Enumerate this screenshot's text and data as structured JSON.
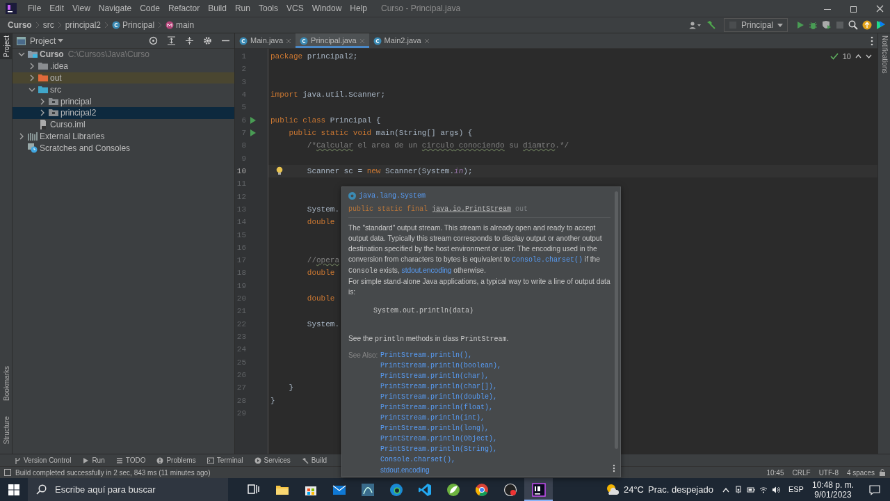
{
  "window": {
    "title": "Curso - Principal.java"
  },
  "menu": [
    "File",
    "Edit",
    "View",
    "Navigate",
    "Code",
    "Refactor",
    "Build",
    "Run",
    "Tools",
    "VCS",
    "Window",
    "Help"
  ],
  "breadcrumbs": [
    {
      "text": "Curso",
      "kind": "project"
    },
    {
      "text": "src",
      "kind": "folder"
    },
    {
      "text": "principal2",
      "kind": "folder"
    },
    {
      "text": "Principal",
      "kind": "class"
    },
    {
      "text": "main",
      "kind": "method"
    }
  ],
  "run_config": {
    "label": "Principal"
  },
  "left_stripe": [
    {
      "label": "Project",
      "selected": true
    },
    {
      "label": "Bookmarks",
      "selected": false
    },
    {
      "label": "Structure",
      "selected": false
    }
  ],
  "right_stripe": [
    {
      "label": "Notifications"
    }
  ],
  "project_panel": {
    "title": "Project",
    "tree": [
      {
        "label": "Curso",
        "kind": "module",
        "path": "C:\\Cursos\\Java\\Curso",
        "expanded": true,
        "selected": false,
        "children": [
          {
            "label": ".idea",
            "kind": "folder",
            "expanded": false,
            "selected": false
          },
          {
            "label": "out",
            "kind": "excluded-folder",
            "expanded": false,
            "selected": false
          },
          {
            "label": "src",
            "kind": "source-folder",
            "expanded": true,
            "selected": false,
            "children": [
              {
                "label": "principal",
                "kind": "package",
                "expanded": false,
                "selected": false
              },
              {
                "label": "principal2",
                "kind": "package",
                "expanded": false,
                "selected": true
              }
            ]
          },
          {
            "label": "Curso.iml",
            "kind": "file",
            "selected": false
          }
        ]
      },
      {
        "label": "External Libraries",
        "kind": "libraries",
        "expanded": false,
        "selected": false
      },
      {
        "label": "Scratches and Consoles",
        "kind": "scratches",
        "selected": false
      }
    ]
  },
  "tabs": [
    {
      "label": "Main.java",
      "selected": false
    },
    {
      "label": "Principal.java",
      "selected": true
    },
    {
      "label": "Main2.java",
      "selected": false
    }
  ],
  "inspections": {
    "count": "10"
  },
  "code_lines": [
    {
      "number": "1",
      "tokens": [
        {
          "text": "package",
          "kind": "kw"
        },
        {
          "text": " principal2;",
          "kind": "plain"
        }
      ]
    },
    {
      "number": "2"
    },
    {
      "number": "3"
    },
    {
      "number": "4",
      "tokens": [
        {
          "text": "import",
          "kind": "kw"
        },
        {
          "text": " java.util.Scanner;",
          "kind": "plain"
        }
      ]
    },
    {
      "number": "5"
    },
    {
      "number": "6",
      "kind": "run",
      "tokens": [
        {
          "text": "public class",
          "kind": "kw"
        },
        {
          "text": " Principal {",
          "kind": "plain"
        }
      ]
    },
    {
      "number": "7",
      "kind": "run",
      "tokens": [
        {
          "text": "    public static void",
          "kind": "kw"
        },
        {
          "text": " main(String[] args) {",
          "kind": "plain"
        }
      ]
    },
    {
      "number": "8",
      "tokens": [
        {
          "text": "        /*",
          "kind": "comment"
        },
        {
          "text": "Calcular",
          "kind": "typo"
        },
        {
          "text": " el area de un ",
          "kind": "comment"
        },
        {
          "text": "circulo",
          "kind": "typo"
        },
        {
          "text": " conociendo",
          "kind": "typo"
        },
        {
          "text": " su ",
          "kind": "comment"
        },
        {
          "text": "diamtro",
          "kind": "typo"
        },
        {
          "text": ".*/",
          "kind": "comment"
        }
      ]
    },
    {
      "number": "9"
    },
    {
      "number": "10",
      "kind": "bulb",
      "current": true,
      "tokens": [
        {
          "text": "        Scanner sc = ",
          "kind": "plain"
        },
        {
          "text": "new",
          "kind": "kw"
        },
        {
          "text": " Scanner(System.",
          "kind": "plain"
        },
        {
          "text": "in",
          "kind": "field"
        },
        {
          "text": ");",
          "kind": "plain"
        }
      ]
    },
    {
      "number": "11"
    },
    {
      "number": "12"
    },
    {
      "number": "13",
      "tokens": [
        {
          "text": "        System.",
          "kind": "plain"
        }
      ]
    },
    {
      "number": "14",
      "tokens": [
        {
          "text": "        double",
          "kind": "kw"
        }
      ]
    },
    {
      "number": "15"
    },
    {
      "number": "16"
    },
    {
      "number": "17",
      "tokens": [
        {
          "text": "        //",
          "kind": "comment"
        },
        {
          "text": "opera",
          "kind": "typo"
        }
      ]
    },
    {
      "number": "18",
      "tokens": [
        {
          "text": "        double",
          "kind": "kw"
        }
      ]
    },
    {
      "number": "19"
    },
    {
      "number": "20",
      "tokens": [
        {
          "text": "        double",
          "kind": "kw"
        }
      ]
    },
    {
      "number": "21"
    },
    {
      "number": "22",
      "tokens": [
        {
          "text": "        System.",
          "kind": "plain"
        }
      ]
    },
    {
      "number": "23"
    },
    {
      "number": "24"
    },
    {
      "number": "25"
    },
    {
      "number": "26"
    },
    {
      "number": "27",
      "tokens": [
        {
          "text": "    }",
          "kind": "plain"
        }
      ]
    },
    {
      "number": "28",
      "tokens": [
        {
          "text": "}",
          "kind": "plain"
        }
      ]
    },
    {
      "number": "29"
    }
  ],
  "doc_popup": {
    "header": "java.lang.System",
    "signature": [
      {
        "text": "public static final",
        "kind": "kw"
      },
      {
        "text": "java.io.PrintStream",
        "kind": "link"
      },
      {
        "text": "out",
        "kind": "dim"
      }
    ],
    "paragraphs": [
      [
        {
          "text": "The \"standard\" output stream. This stream is already open and ready to accept output data. Typically this stream corresponds to display output or another output destination specified by the host environment or user. The encoding used in the conversion from characters to bytes is equivalent to ",
          "kind": "text"
        },
        {
          "text": "Console.charset()",
          "kind": "code-link"
        },
        {
          "text": " if the ",
          "kind": "text"
        },
        {
          "text": "Console",
          "kind": "code"
        },
        {
          "text": " exists, ",
          "kind": "text"
        },
        {
          "text": "stdout.encoding",
          "kind": "link"
        },
        {
          "text": " otherwise.",
          "kind": "text"
        }
      ],
      [
        {
          "text": "For simple stand-alone Java applications, a typical way to write a line of output data is:",
          "kind": "text"
        }
      ]
    ],
    "code_sample": "System.out.println(data)",
    "see_the": [
      {
        "text": "See the ",
        "kind": "text"
      },
      {
        "text": "println",
        "kind": "code"
      },
      {
        "text": " methods in class ",
        "kind": "text"
      },
      {
        "text": "PrintStream",
        "kind": "code"
      },
      {
        "text": ".",
        "kind": "text"
      }
    ],
    "see_also_label": "See Also:",
    "see_also": [
      {
        "text": "PrintStream.println(),",
        "kind": "code"
      },
      {
        "text": "PrintStream.println(boolean),",
        "kind": "code"
      },
      {
        "text": "PrintStream.println(char),",
        "kind": "code"
      },
      {
        "text": "PrintStream.println(char[]),",
        "kind": "code"
      },
      {
        "text": "PrintStream.println(double),",
        "kind": "code"
      },
      {
        "text": "PrintStream.println(float),",
        "kind": "code"
      },
      {
        "text": "PrintStream.println(int),",
        "kind": "code"
      },
      {
        "text": "PrintStream.println(long),",
        "kind": "code"
      },
      {
        "text": "PrintStream.println(Object),",
        "kind": "code"
      },
      {
        "text": "PrintStream.println(String),",
        "kind": "code"
      },
      {
        "text": "Console.charset(),",
        "kind": "code"
      },
      {
        "text": "stdout.encoding",
        "kind": "text"
      }
    ]
  },
  "tool_windows": [
    {
      "label": "Version Control",
      "kind": "branch"
    },
    {
      "label": "Run",
      "kind": "run"
    },
    {
      "label": "TODO",
      "kind": "list"
    },
    {
      "label": "Problems",
      "kind": "problems"
    },
    {
      "label": "Terminal",
      "kind": "terminal"
    },
    {
      "label": "Services",
      "kind": "services"
    },
    {
      "label": "Build",
      "kind": "hammer"
    }
  ],
  "status_bar": {
    "message": "Build completed successfully in 2 sec, 843 ms (11 minutes ago)",
    "items": [
      "10:45",
      "CRLF",
      "UTF-8",
      "4 spaces"
    ]
  },
  "taskbar": {
    "search_placeholder": "Escribe aquí para buscar",
    "apps": [
      {
        "kind": "task-view",
        "selected": false
      },
      {
        "kind": "folder",
        "selected": false
      },
      {
        "kind": "store",
        "selected": false
      },
      {
        "kind": "mail",
        "selected": false
      },
      {
        "kind": "database",
        "selected": false
      },
      {
        "kind": "edge",
        "selected": false
      },
      {
        "kind": "vscode",
        "selected": false
      },
      {
        "kind": "leaf",
        "selected": false
      },
      {
        "kind": "chrome",
        "selected": false
      },
      {
        "kind": "recorder",
        "selected": false
      },
      {
        "kind": "intellij",
        "selected": true
      }
    ],
    "temperature": "24°C",
    "weather": "Prac. despejado",
    "language": "ESP",
    "time": "10:48 p. m.",
    "date": "9/01/2023"
  }
}
